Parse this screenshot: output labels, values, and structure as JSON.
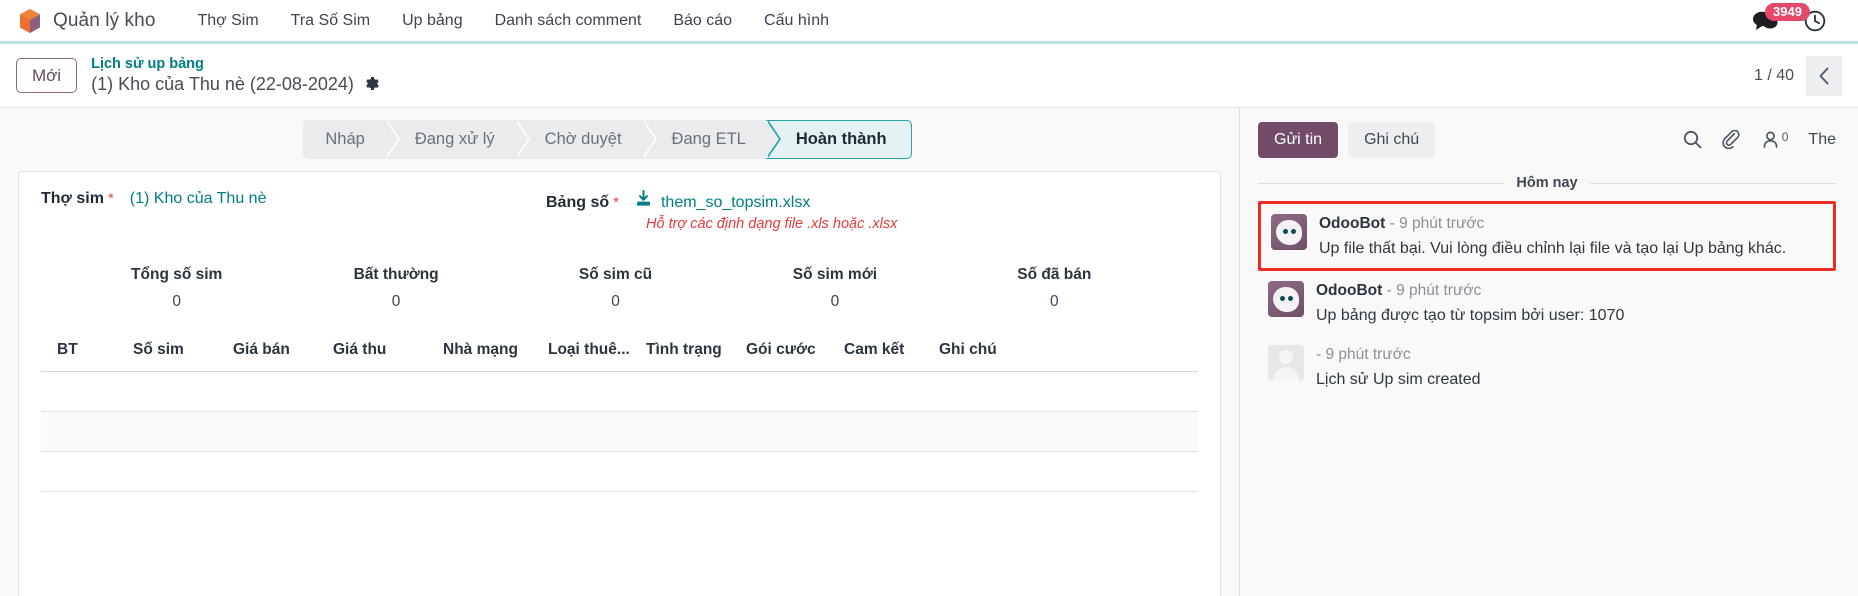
{
  "navbar": {
    "brand": "Quản lý kho",
    "logo_icon": "cube-icon",
    "links": [
      {
        "label": "Thợ Sim"
      },
      {
        "label": "Tra Số Sim"
      },
      {
        "label": "Up bảng"
      },
      {
        "label": "Danh sách comment"
      },
      {
        "label": "Báo cáo"
      },
      {
        "label": "Cấu hình"
      }
    ],
    "messages_icon": "comments-icon",
    "messages_badge": "3949",
    "activity_icon": "clock-icon"
  },
  "control_panel": {
    "new_button": "Mới",
    "breadcrumb_parent": "Lịch sử up bảng",
    "breadcrumb_current": "(1) Kho của Thu nè (22-08-2024)",
    "settings_icon": "gear-icon",
    "pager_text": "1 / 40",
    "pager_prev_icon": "chevron-left-icon"
  },
  "statusbar": {
    "stages": [
      {
        "label": "Nháp",
        "active": false
      },
      {
        "label": "Đang xử lý",
        "active": false
      },
      {
        "label": "Chờ duyệt",
        "active": false
      },
      {
        "label": "Đang ETL",
        "active": false
      },
      {
        "label": "Hoàn thành",
        "active": true
      }
    ]
  },
  "form": {
    "tho_sim_label": "Thợ sim",
    "tho_sim_value": "(1) Kho của Thu nè",
    "bang_so_label": "Bảng số",
    "bang_so_file": "them_so_topsim.xlsx",
    "download_icon": "download-icon",
    "help_text": "Hỗ trợ các định dạng file .xls hoặc .xlsx",
    "required_marker": "*",
    "stats": [
      {
        "label": "Tổng số sim",
        "value": "0"
      },
      {
        "label": "Bất thường",
        "value": "0"
      },
      {
        "label": "Số sim cũ",
        "value": "0"
      },
      {
        "label": "Số sim mới",
        "value": "0"
      },
      {
        "label": "Số đã bán",
        "value": "0"
      }
    ],
    "table_headers": [
      "BT",
      "Số sim",
      "Giá bán",
      "Giá thu",
      "Nhà mạng",
      "Loại thuê...",
      "Tình trạng",
      "Gói cước",
      "Cam kết",
      "Ghi chú"
    ],
    "table_rows": []
  },
  "chatter": {
    "send_button": "Gửi tin",
    "note_button": "Ghi chú",
    "search_icon": "search-icon",
    "attachment_icon": "paperclip-icon",
    "follower_icon": "user-outline-icon",
    "follower_count": "0",
    "follow_label": "The",
    "day_separator": "Hôm nay",
    "messages": [
      {
        "author": "OdooBot",
        "time": "- 9 phút trước",
        "text": "Up file thất bại. Vui lòng điều chỉnh lại file và tạo lại Up bảng khác.",
        "avatar": "bot",
        "flagged": true
      },
      {
        "author": "OdooBot",
        "time": "- 9 phút trước",
        "text": "Up bảng được tạo từ topsim bởi user: 1070",
        "avatar": "bot",
        "flagged": false
      },
      {
        "author": "",
        "time": "- 9 phút trước",
        "text": "Lịch sử Up sim created",
        "avatar": "user",
        "flagged": false
      }
    ]
  },
  "colors": {
    "brand_purple": "#714b67",
    "teal_link": "#017e84",
    "badge_red": "#e4486b",
    "alert_red": "#ee2b27",
    "help_red": "#e83a3a",
    "navbar_underline": "#b9e0e2"
  }
}
